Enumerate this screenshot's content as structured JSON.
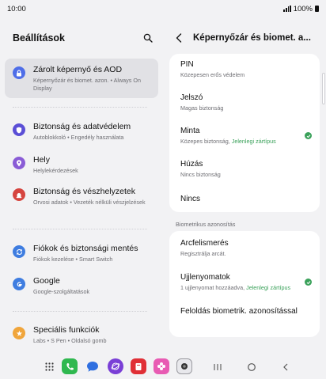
{
  "status": {
    "time": "10:00",
    "battery": "100%"
  },
  "left": {
    "title": "Beállítások",
    "items": [
      {
        "title": "Zárolt képernyő és AOD",
        "subtitle": "Képernyőzár és biomet. azon.  •  Always On Display",
        "icon": "lock-icon",
        "color": "#4f6ee8"
      },
      {
        "title": "Biztonság és adatvédelem",
        "subtitle": "Autoblokkoló  •  Engedély használata",
        "icon": "shield-icon",
        "color": "#5b4fd6"
      },
      {
        "title": "Hely",
        "subtitle": "Helylekérdezések",
        "icon": "location-icon",
        "color": "#8a5cd6"
      },
      {
        "title": "Biztonság és vészhelyzetek",
        "subtitle": "Orvosi adatok  •  Vezeték nélküli vészjelzések",
        "icon": "emergency-icon",
        "color": "#d6453f"
      },
      {
        "title": "Fiókok és biztonsági mentés",
        "subtitle": "Fiókok kezelése  •  Smart Switch",
        "icon": "sync-icon",
        "color": "#3f7de0"
      },
      {
        "title": "Google",
        "subtitle": "Google-szolgáltatások",
        "icon": "google-icon",
        "color": "#3f7de0"
      },
      {
        "title": "Speciális funkciók",
        "subtitle": "Labs  •  S Pen  •  Oldalsó gomb",
        "icon": "star-icon",
        "color": "#f0a53b"
      }
    ]
  },
  "right": {
    "title": "Képernyőzár és biomet. a...",
    "options": [
      {
        "title": "PIN",
        "subtitle": "Közepesen erős védelem"
      },
      {
        "title": "Jelszó",
        "subtitle": "Magas biztonság"
      },
      {
        "title": "Minta",
        "subtitle": "Közepes biztonság, ",
        "current": "Jelenlegi zártípus"
      },
      {
        "title": "Húzás",
        "subtitle": "Nincs biztonság"
      },
      {
        "title": "Nincs"
      }
    ],
    "biometrics_label": "Biometrikus azonosítás",
    "biometrics": [
      {
        "title": "Arcfelismerés",
        "subtitle": "Regisztrálja arcát."
      },
      {
        "title": "Ujjlenyomatok",
        "subtitle": "1 ujjlenyomat hozzáadva, ",
        "current": "Jelenlegi zártípus"
      },
      {
        "title": "Feloldás biometrik. azonosítással"
      }
    ]
  },
  "colors": {
    "accent_green": "#3aa15a",
    "selected_bg": "#e1e1e5"
  }
}
